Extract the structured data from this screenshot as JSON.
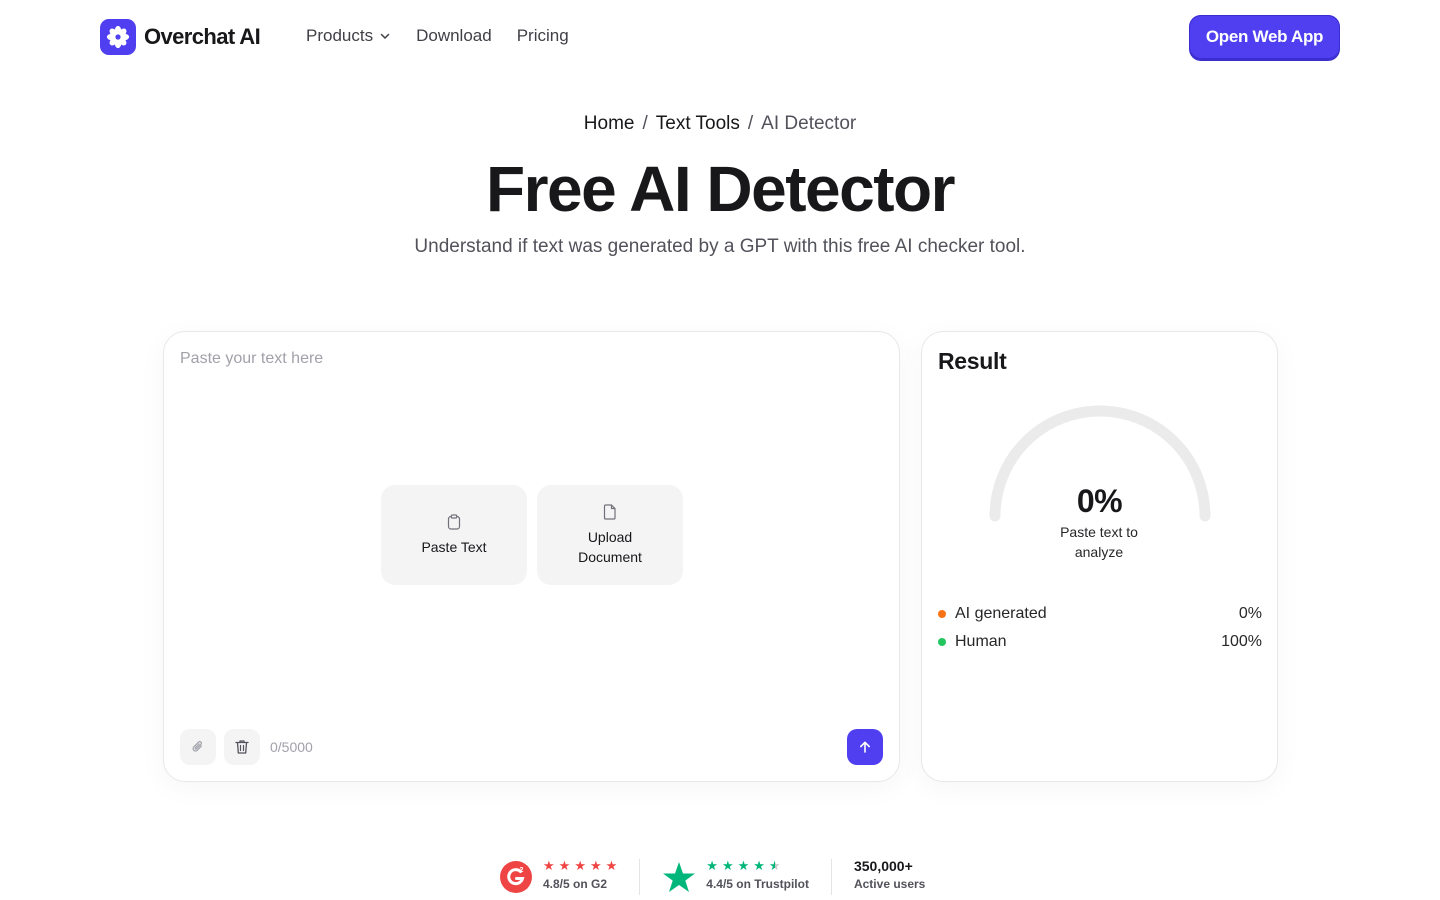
{
  "brand": {
    "name": "Overchat AI",
    "accent": "#4f3ff0"
  },
  "nav": {
    "links": [
      {
        "label": "Products",
        "has_dropdown": true,
        "icon": "chevron-down-icon"
      },
      {
        "label": "Download"
      },
      {
        "label": "Pricing"
      }
    ],
    "cta_label": "Open Web App"
  },
  "breadcrumb": {
    "items": [
      "Home",
      "Text Tools",
      "AI Detector"
    ],
    "separator": "/"
  },
  "hero": {
    "title": "Free AI Detector",
    "subtitle": "Understand if text was generated by a GPT with this free AI checker tool."
  },
  "input": {
    "placeholder": "Paste your text here",
    "value": "",
    "paste_label": "Paste Text",
    "paste_icon": "clipboard-icon",
    "upload_label": "Upload\nDocument",
    "upload_icon": "document-icon",
    "attach_icon": "paperclip-icon",
    "clear_icon": "trash-icon",
    "submit_icon": "arrow-up-icon",
    "counter": "0/5000"
  },
  "result": {
    "title": "Result",
    "gauge_value": "0%",
    "gauge_fraction": 0,
    "caption": "Paste text to analyze",
    "legend": [
      {
        "label": "AI generated",
        "value": "0%",
        "color": "#f97316"
      },
      {
        "label": "Human",
        "value": "100%",
        "color": "#22c55e"
      }
    ]
  },
  "ratings": {
    "g2": {
      "text": "4.8/5 on G2",
      "stars": 5,
      "color": "#ef4444",
      "icon": "g2-logo-icon"
    },
    "trustpilot": {
      "text": "4.4/5 on Trustpilot",
      "stars": 4.5,
      "color": "#00b67a",
      "icon": "trustpilot-star-icon"
    },
    "users": {
      "count": "350,000+",
      "label": "Active users"
    }
  }
}
